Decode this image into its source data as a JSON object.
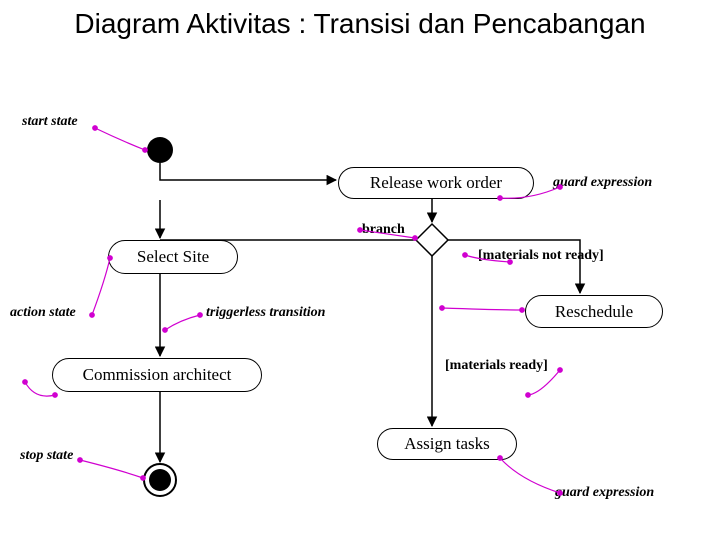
{
  "title": "Diagram Aktivitas : Transisi dan Pencabangan",
  "labels": {
    "start_state": "start state",
    "branch": "branch",
    "action_state": "action state",
    "triggerless_transition": "triggerless transition",
    "stop_state": "stop state",
    "guard_expression": "guard expression"
  },
  "activities": {
    "release_work_order": "Release work order",
    "select_site": "Select Site",
    "reschedule": "Reschedule",
    "commission_architect": "Commission architect",
    "assign_tasks": "Assign tasks"
  },
  "guards": {
    "materials_not_ready": "[materials not ready]",
    "materials_ready": "[materials ready]"
  }
}
